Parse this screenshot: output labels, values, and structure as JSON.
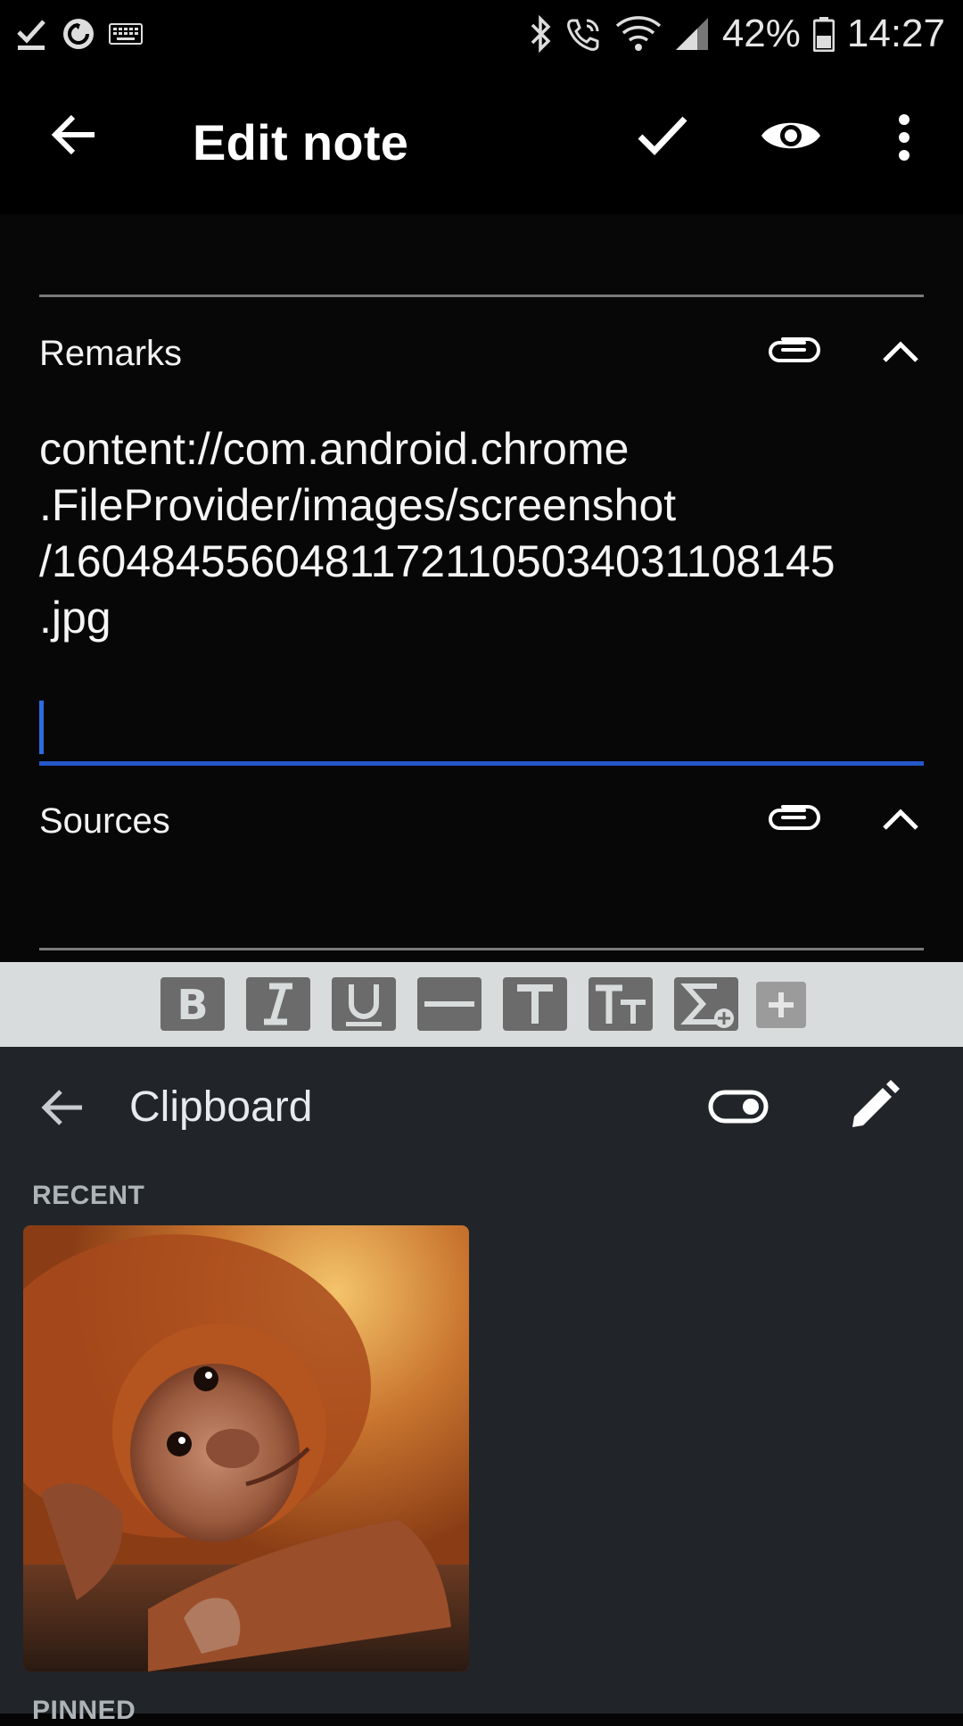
{
  "status_bar": {
    "battery_percent": "42%",
    "time": "14:27",
    "left_icons": [
      "download-done-icon",
      "sync-icon",
      "keyboard-icon"
    ],
    "right_icons": [
      "bluetooth-icon",
      "wifi-calling-icon",
      "wifi-icon",
      "signal-icon",
      "battery-icon"
    ]
  },
  "app_bar": {
    "title": "Edit note",
    "icons": [
      "back-arrow-icon",
      "check-icon",
      "eye-icon",
      "more-vert-icon"
    ]
  },
  "editor": {
    "remarks": {
      "label": "Remarks",
      "text": "content://com.android.chrome\n.FileProvider/images/screenshot\n/160484556048117211050340311081​45\n.jpg",
      "cursor_line": ""
    },
    "sources": {
      "label": "Sources"
    },
    "section_icons": [
      "paperclip-icon",
      "chevron-up-icon"
    ]
  },
  "format_toolbar": {
    "buttons": [
      "bold",
      "italic",
      "underline",
      "strikethrough",
      "text-size",
      "text-style",
      "formula",
      "add"
    ]
  },
  "clipboard": {
    "title": "Clipboard",
    "recent_label": "RECENT",
    "pinned_label": "PINNED",
    "items": [
      {
        "type": "image",
        "subject": "orangutan-photo"
      }
    ],
    "icons": [
      "back-arrow-icon",
      "toggle-icon",
      "pencil-icon"
    ]
  },
  "colors": {
    "accent": "#2558c9",
    "clipboard_bg": "#212529",
    "toolbar_bg": "#d9dcdc"
  }
}
